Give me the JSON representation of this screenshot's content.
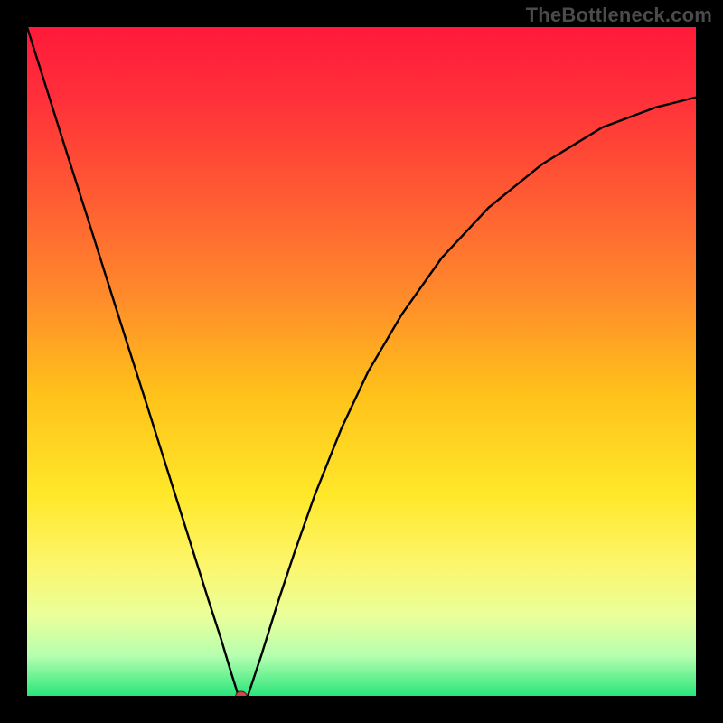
{
  "watermark": "TheBottleneck.com",
  "colors": {
    "frame_bg": "#000000",
    "curve_stroke": "#000000",
    "marker_fill": "#c94a48",
    "marker_stroke": "#651514"
  },
  "gradient_stops": [
    {
      "offset": 0.0,
      "color": "#ff1a3a"
    },
    {
      "offset": 0.1,
      "color": "#ff2e3a"
    },
    {
      "offset": 0.25,
      "color": "#ff5a33"
    },
    {
      "offset": 0.4,
      "color": "#ff8a2b"
    },
    {
      "offset": 0.55,
      "color": "#ffc21a"
    },
    {
      "offset": 0.7,
      "color": "#ffe82a"
    },
    {
      "offset": 0.8,
      "color": "#fdf56a"
    },
    {
      "offset": 0.88,
      "color": "#eaff9a"
    },
    {
      "offset": 0.94,
      "color": "#b6ffb0"
    },
    {
      "offset": 1.0,
      "color": "#29e57a"
    }
  ],
  "chart_data": {
    "type": "line",
    "title": "",
    "xlabel": "",
    "ylabel": "",
    "xlim": [
      0,
      1
    ],
    "ylim": [
      0,
      1
    ],
    "grid": false,
    "legend": false,
    "series": [
      {
        "name": "curve",
        "x": [
          0.0,
          0.03,
          0.06,
          0.09,
          0.12,
          0.15,
          0.18,
          0.21,
          0.24,
          0.27,
          0.29,
          0.305,
          0.316,
          0.32,
          0.33,
          0.35,
          0.375,
          0.4,
          0.43,
          0.47,
          0.51,
          0.56,
          0.62,
          0.69,
          0.77,
          0.86,
          0.94,
          1.0
        ],
        "y": [
          1.0,
          0.905,
          0.81,
          0.716,
          0.621,
          0.526,
          0.432,
          0.337,
          0.242,
          0.147,
          0.085,
          0.035,
          0.0,
          0.0,
          0.0,
          0.06,
          0.14,
          0.215,
          0.3,
          0.4,
          0.485,
          0.57,
          0.655,
          0.73,
          0.795,
          0.85,
          0.88,
          0.895
        ]
      }
    ],
    "annotations": [
      {
        "name": "marker",
        "x": 0.32,
        "y": 0.0,
        "shape": "ellipse"
      }
    ]
  }
}
